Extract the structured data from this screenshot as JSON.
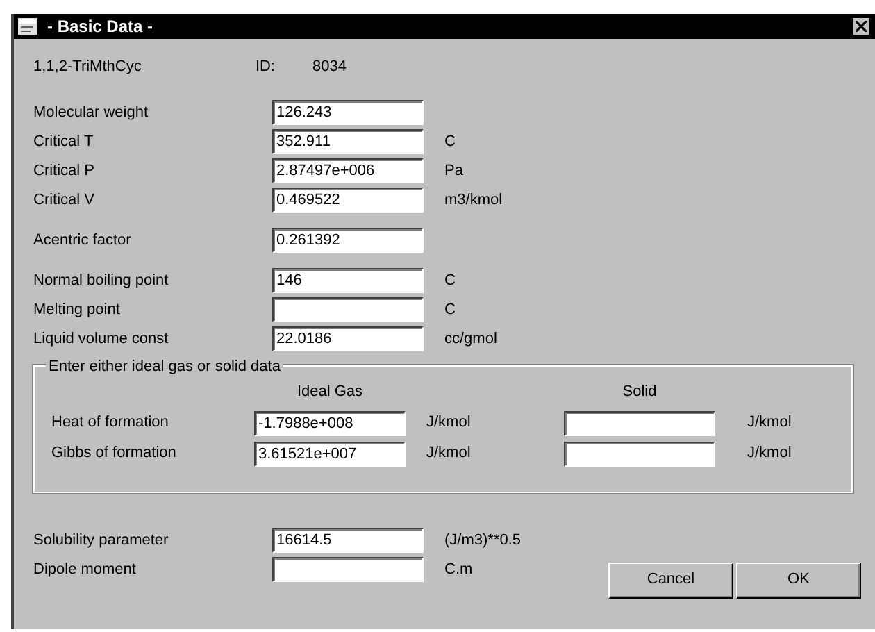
{
  "window": {
    "title": "- Basic Data -"
  },
  "compound": {
    "name": "1,1,2-TriMthCyc",
    "id_label": "ID:",
    "id_value": "8034"
  },
  "property_groups": [
    [
      {
        "label": "Molecular weight",
        "value": "126.243"
      },
      {
        "label": "Critical T",
        "value": "352.911",
        "unit": "C"
      },
      {
        "label": "Critical P",
        "value": "2.87497e+006",
        "unit": "Pa"
      },
      {
        "label": "Critical V",
        "value": "0.469522",
        "unit": "m3/kmol"
      }
    ],
    [
      {
        "label": "Acentric factor",
        "value": "0.261392"
      }
    ],
    [
      {
        "label": "Normal boiling point",
        "value": "146",
        "unit": "C"
      },
      {
        "label": "Melting point",
        "unit": "C"
      },
      {
        "label": "Liquid volume const",
        "value": "22.0186",
        "unit": "cc/gmol"
      }
    ]
  ],
  "formation_group": {
    "legend": "Enter either ideal gas or solid data",
    "headers": [
      "Ideal Gas",
      "Solid"
    ],
    "rows": [
      {
        "label": "Heat of formation",
        "ideal_value": "-1.7988e+008",
        "ideal_unit": "J/kmol",
        "solid_unit": "J/kmol"
      },
      {
        "label": "Gibbs of formation",
        "ideal_value": "3.61521e+007",
        "ideal_unit": "J/kmol",
        "solid_unit": "J/kmol"
      }
    ]
  },
  "extra_properties": [
    {
      "label": "Solubility parameter",
      "value": "16614.5",
      "unit": "(J/m3)**0.5"
    },
    {
      "label": "Dipole moment",
      "unit": "C.m"
    }
  ],
  "buttons": [
    "Cancel",
    "OK"
  ]
}
